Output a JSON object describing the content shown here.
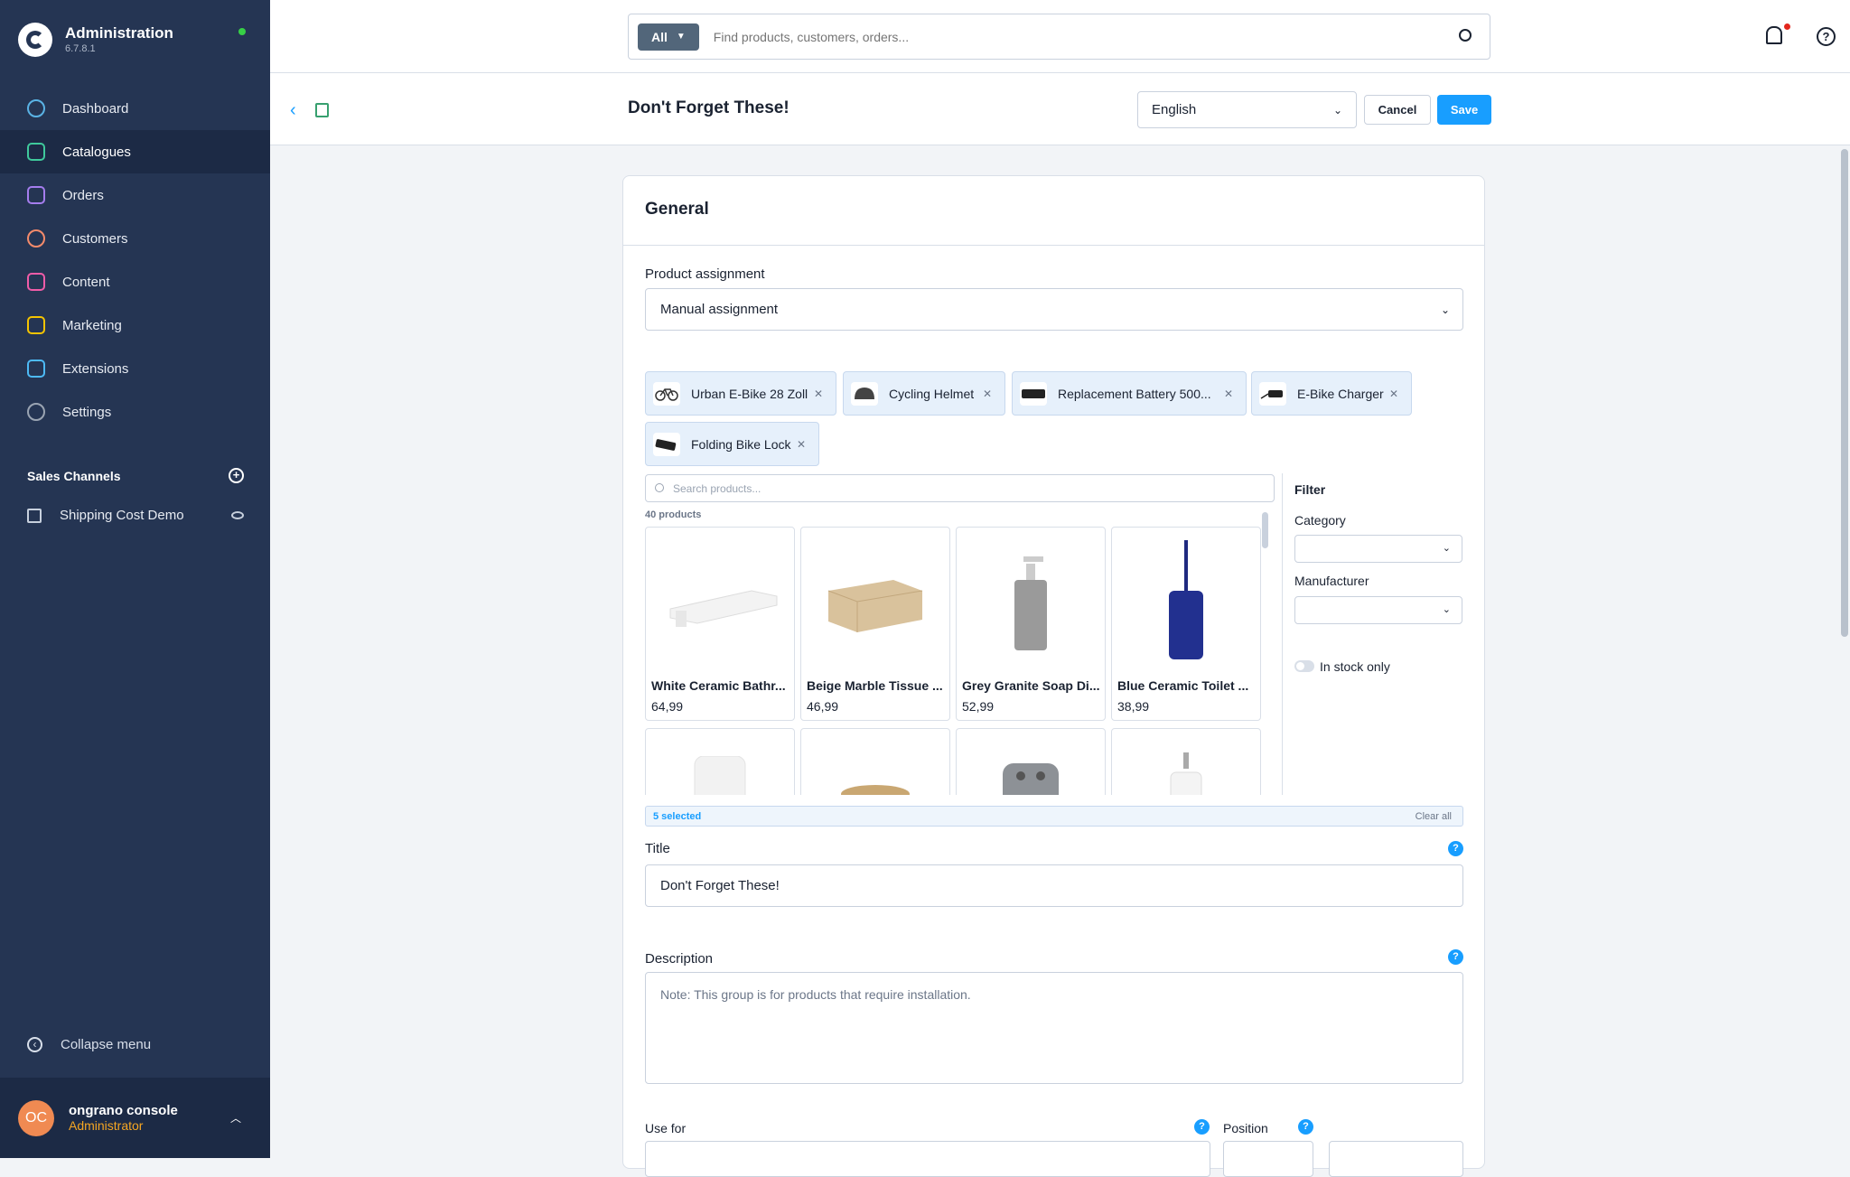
{
  "app": {
    "title": "Administration",
    "version": "6.7.8.1"
  },
  "nav": [
    {
      "label": "Dashboard",
      "icon": "dashboard-icon",
      "color": "#5ab3e5"
    },
    {
      "label": "Catalogues",
      "icon": "catalogue-icon",
      "color": "#3fc99c"
    },
    {
      "label": "Orders",
      "icon": "orders-icon",
      "color": "#a57dee"
    },
    {
      "label": "Customers",
      "icon": "customers-icon",
      "color": "#f58b6b"
    },
    {
      "label": "Content",
      "icon": "content-icon",
      "color": "#f05ca8"
    },
    {
      "label": "Marketing",
      "icon": "marketing-icon",
      "color": "#f5c400"
    },
    {
      "label": "Extensions",
      "icon": "extensions-icon",
      "color": "#4dbaf5"
    },
    {
      "label": "Settings",
      "icon": "settings-icon",
      "color": "#9aa4b2"
    }
  ],
  "sales_channels": {
    "heading": "Sales Channels",
    "items": [
      {
        "label": "Shipping Cost Demo"
      }
    ]
  },
  "collapse_label": "Collapse menu",
  "user": {
    "initials": "OC",
    "name": "ongrano console",
    "role": "Administrator"
  },
  "search": {
    "scope": "All",
    "placeholder": "Find products, customers, orders..."
  },
  "page": {
    "title": "Don't Forget These!",
    "language": "English",
    "cancel": "Cancel",
    "save": "Save"
  },
  "card": {
    "heading": "General"
  },
  "assignment": {
    "label": "Product assignment",
    "value": "Manual assignment"
  },
  "chips": [
    {
      "label": "Urban E-Bike 28 Zoll"
    },
    {
      "label": "Cycling Helmet"
    },
    {
      "label": "Replacement Battery 500..."
    },
    {
      "label": "E-Bike Charger"
    },
    {
      "label": "Folding Bike Lock"
    }
  ],
  "product_search": {
    "placeholder": "Search products...",
    "count": "40 products"
  },
  "products": [
    {
      "name": "White Ceramic Bathr...",
      "price": "64,99"
    },
    {
      "name": "Beige Marble Tissue ...",
      "price": "46,99"
    },
    {
      "name": "Grey Granite Soap Di...",
      "price": "52,99"
    },
    {
      "name": "Blue Ceramic Toilet ...",
      "price": "38,99"
    },
    {
      "name": "",
      "price": ""
    },
    {
      "name": "",
      "price": ""
    },
    {
      "name": "",
      "price": ""
    },
    {
      "name": "",
      "price": ""
    }
  ],
  "filter": {
    "heading": "Filter",
    "category": "Category",
    "manufacturer": "Manufacturer",
    "stock": "In stock only"
  },
  "selection": {
    "count": "5 selected",
    "clear": "Clear all"
  },
  "title_field": {
    "label": "Title",
    "value": "Don't Forget These!"
  },
  "description": {
    "label": "Description",
    "placeholder": "Note: This group is for products that require installation."
  },
  "bottom": {
    "use_for": "Use for",
    "position": "Position"
  },
  "colors": {
    "sidebar": "#253553",
    "accent": "#189eff",
    "chip": "#e6f0fb"
  }
}
